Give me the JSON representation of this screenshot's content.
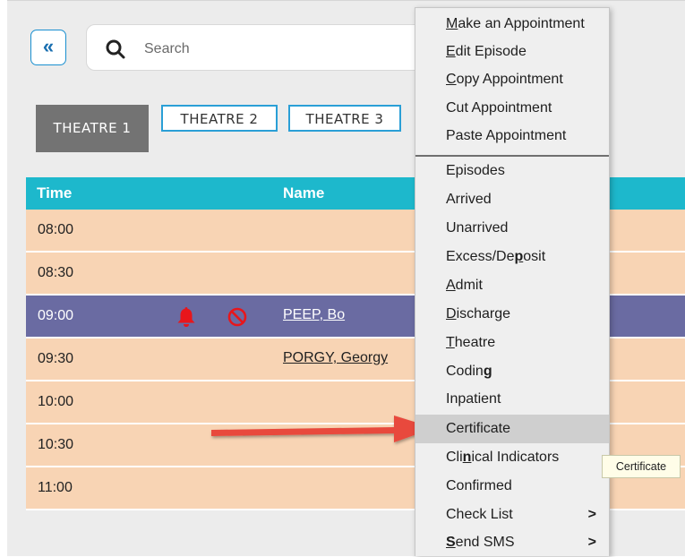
{
  "toolbar": {
    "collapse_icon": "double-chevron-left-icon",
    "search_placeholder": "Search",
    "search_value": ""
  },
  "tabs": [
    {
      "label": "THEATRE 1",
      "active": true
    },
    {
      "label": "THEATRE 2",
      "active": false
    },
    {
      "label": "THEATRE 3",
      "active": false
    }
  ],
  "grid": {
    "columns": [
      "Time",
      "Name"
    ],
    "rows": [
      {
        "time": "08:00",
        "name": ""
      },
      {
        "time": "08:30",
        "name": ""
      },
      {
        "time": "09:00",
        "name": "PEEP, Bo",
        "selected": true,
        "icons": [
          "bell-icon",
          "no-entry-icon"
        ]
      },
      {
        "time": "09:30",
        "name": "PORGY, Georgy"
      },
      {
        "time": "10:00",
        "name": ""
      },
      {
        "time": "10:30",
        "name": ""
      },
      {
        "time": "11:00",
        "name": ""
      }
    ]
  },
  "context_menu": {
    "items": [
      {
        "label": "Make an Appointment",
        "accel": "M"
      },
      {
        "label": "Edit Episode",
        "accel": "E"
      },
      {
        "label": "Copy Appointment",
        "accel": "C"
      },
      {
        "label": "Cut Appointment"
      },
      {
        "label": "Paste Appointment"
      },
      {
        "label": "Episodes"
      },
      {
        "label": "Arrived"
      },
      {
        "label": "Unarrived"
      },
      {
        "label": "Excess/Deposit",
        "accel": "p"
      },
      {
        "label": "Admit",
        "accel": "A"
      },
      {
        "label": "Discharge",
        "accel": "D"
      },
      {
        "label": "Theatre",
        "accel": "T"
      },
      {
        "label": "Coding",
        "accel": "g"
      },
      {
        "label": "Inpatient"
      },
      {
        "label": "Certificate",
        "hover": true
      },
      {
        "label": "Clinical Indicators",
        "accel": "n"
      },
      {
        "label": "Confirmed"
      },
      {
        "label": "Check List",
        "submenu": ">"
      },
      {
        "label": "Send SMS",
        "accel": "S",
        "submenu": ">"
      }
    ]
  },
  "tooltip": {
    "text": "Certificate"
  },
  "colors": {
    "header": "#1db8cc",
    "row": "#f8d4b4",
    "selected_row": "#6a6ba2",
    "alert_red": "#e8161b",
    "annotation_arrow": "#e8483c"
  }
}
